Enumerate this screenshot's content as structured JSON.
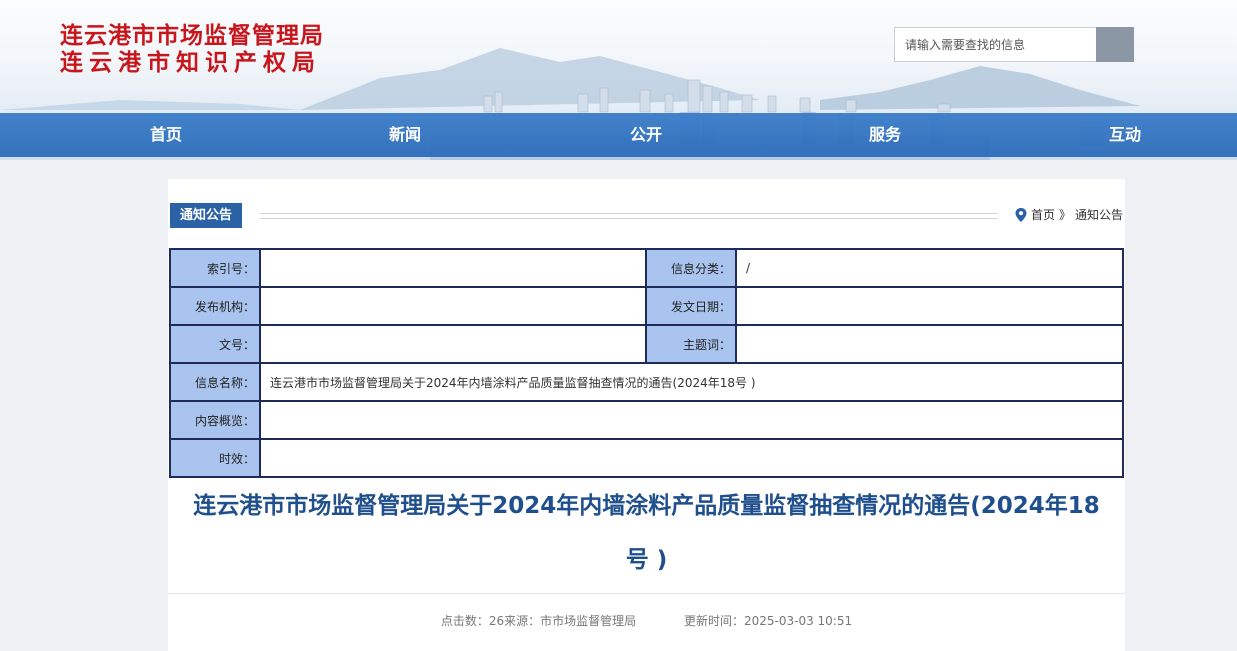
{
  "header": {
    "title_line1": "连云港市市场监督管理局",
    "title_line2": "连云港市知识产权局",
    "search_placeholder": "请输入需要查找的信息"
  },
  "nav": [
    "首页",
    "新闻",
    "公开",
    "服务",
    "互动"
  ],
  "column": {
    "name": "通知公告",
    "breadcrumb": [
      "首页",
      "》",
      "通知公告"
    ]
  },
  "meta": {
    "index_label": "索引号：",
    "index_value": "",
    "category_label": "信息分类：",
    "category_value": "/",
    "publisher_label": "发布机构：",
    "publisher_value": "",
    "date_label": "发文日期：",
    "date_value": "",
    "docno_label": "文号：",
    "docno_value": "",
    "subject_label": "主题词：",
    "subject_value": "",
    "name_label": "信息名称：",
    "name_value": "连云港市市场监督管理局关于2024年内墙涂料产品质量监督抽查情况的通告(2024年18号 )",
    "summary_label": "内容概览：",
    "summary_value": "",
    "validity_label": "时效：",
    "validity_value": ""
  },
  "article": {
    "title_line1": "连云港市市场监督管理局关于2024年内墙涂料产品质量监督抽查情况的通告(2024年18",
    "title_line2": "号 )",
    "clicks": "点击数：26",
    "source": "来源：市市场监督管理局",
    "updated": "更新时间：2025-03-03 10:51"
  },
  "colors": {
    "brand_red": "#c8161d",
    "nav_blue": "#2f6fbf",
    "label_bg": "#a9c4ef",
    "title_blue": "#1f4f8c"
  }
}
